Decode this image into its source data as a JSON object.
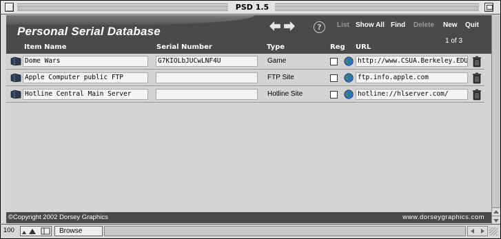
{
  "window": {
    "title": "PSD 1.5"
  },
  "header": {
    "app_title": "Personal Serial Database",
    "buttons": {
      "list": "List",
      "show_all": "Show All",
      "find": "Find",
      "delete": "Delete",
      "new": "New",
      "quit": "Quit"
    },
    "help": "?",
    "page_count": "1 of 3"
  },
  "columns": {
    "item_name": "Item Name",
    "serial_number": "Serial Number",
    "type": "Type",
    "reg": "Reg",
    "url": "URL"
  },
  "rows": [
    {
      "name": "Dome Wars",
      "serial": "G7KIOLbJUCwLNF4U",
      "type": "Game",
      "reg": false,
      "url": "http://www.CSUA.Berkeley.EDU"
    },
    {
      "name": "Apple Computer public FTP",
      "serial": "",
      "type": "FTP Site",
      "reg": false,
      "url": "ftp.info.apple.com"
    },
    {
      "name": "Hotline Central Main Server",
      "serial": "",
      "type": "Hotline Site",
      "reg": false,
      "url": "hotline://hlserver.com/"
    }
  ],
  "footer": {
    "copyright": "©Copyright 2002 Dorsey Graphics",
    "website": "www.dorseygraphics.com"
  },
  "statusbar": {
    "zoom": "100",
    "mode": "Browse"
  }
}
